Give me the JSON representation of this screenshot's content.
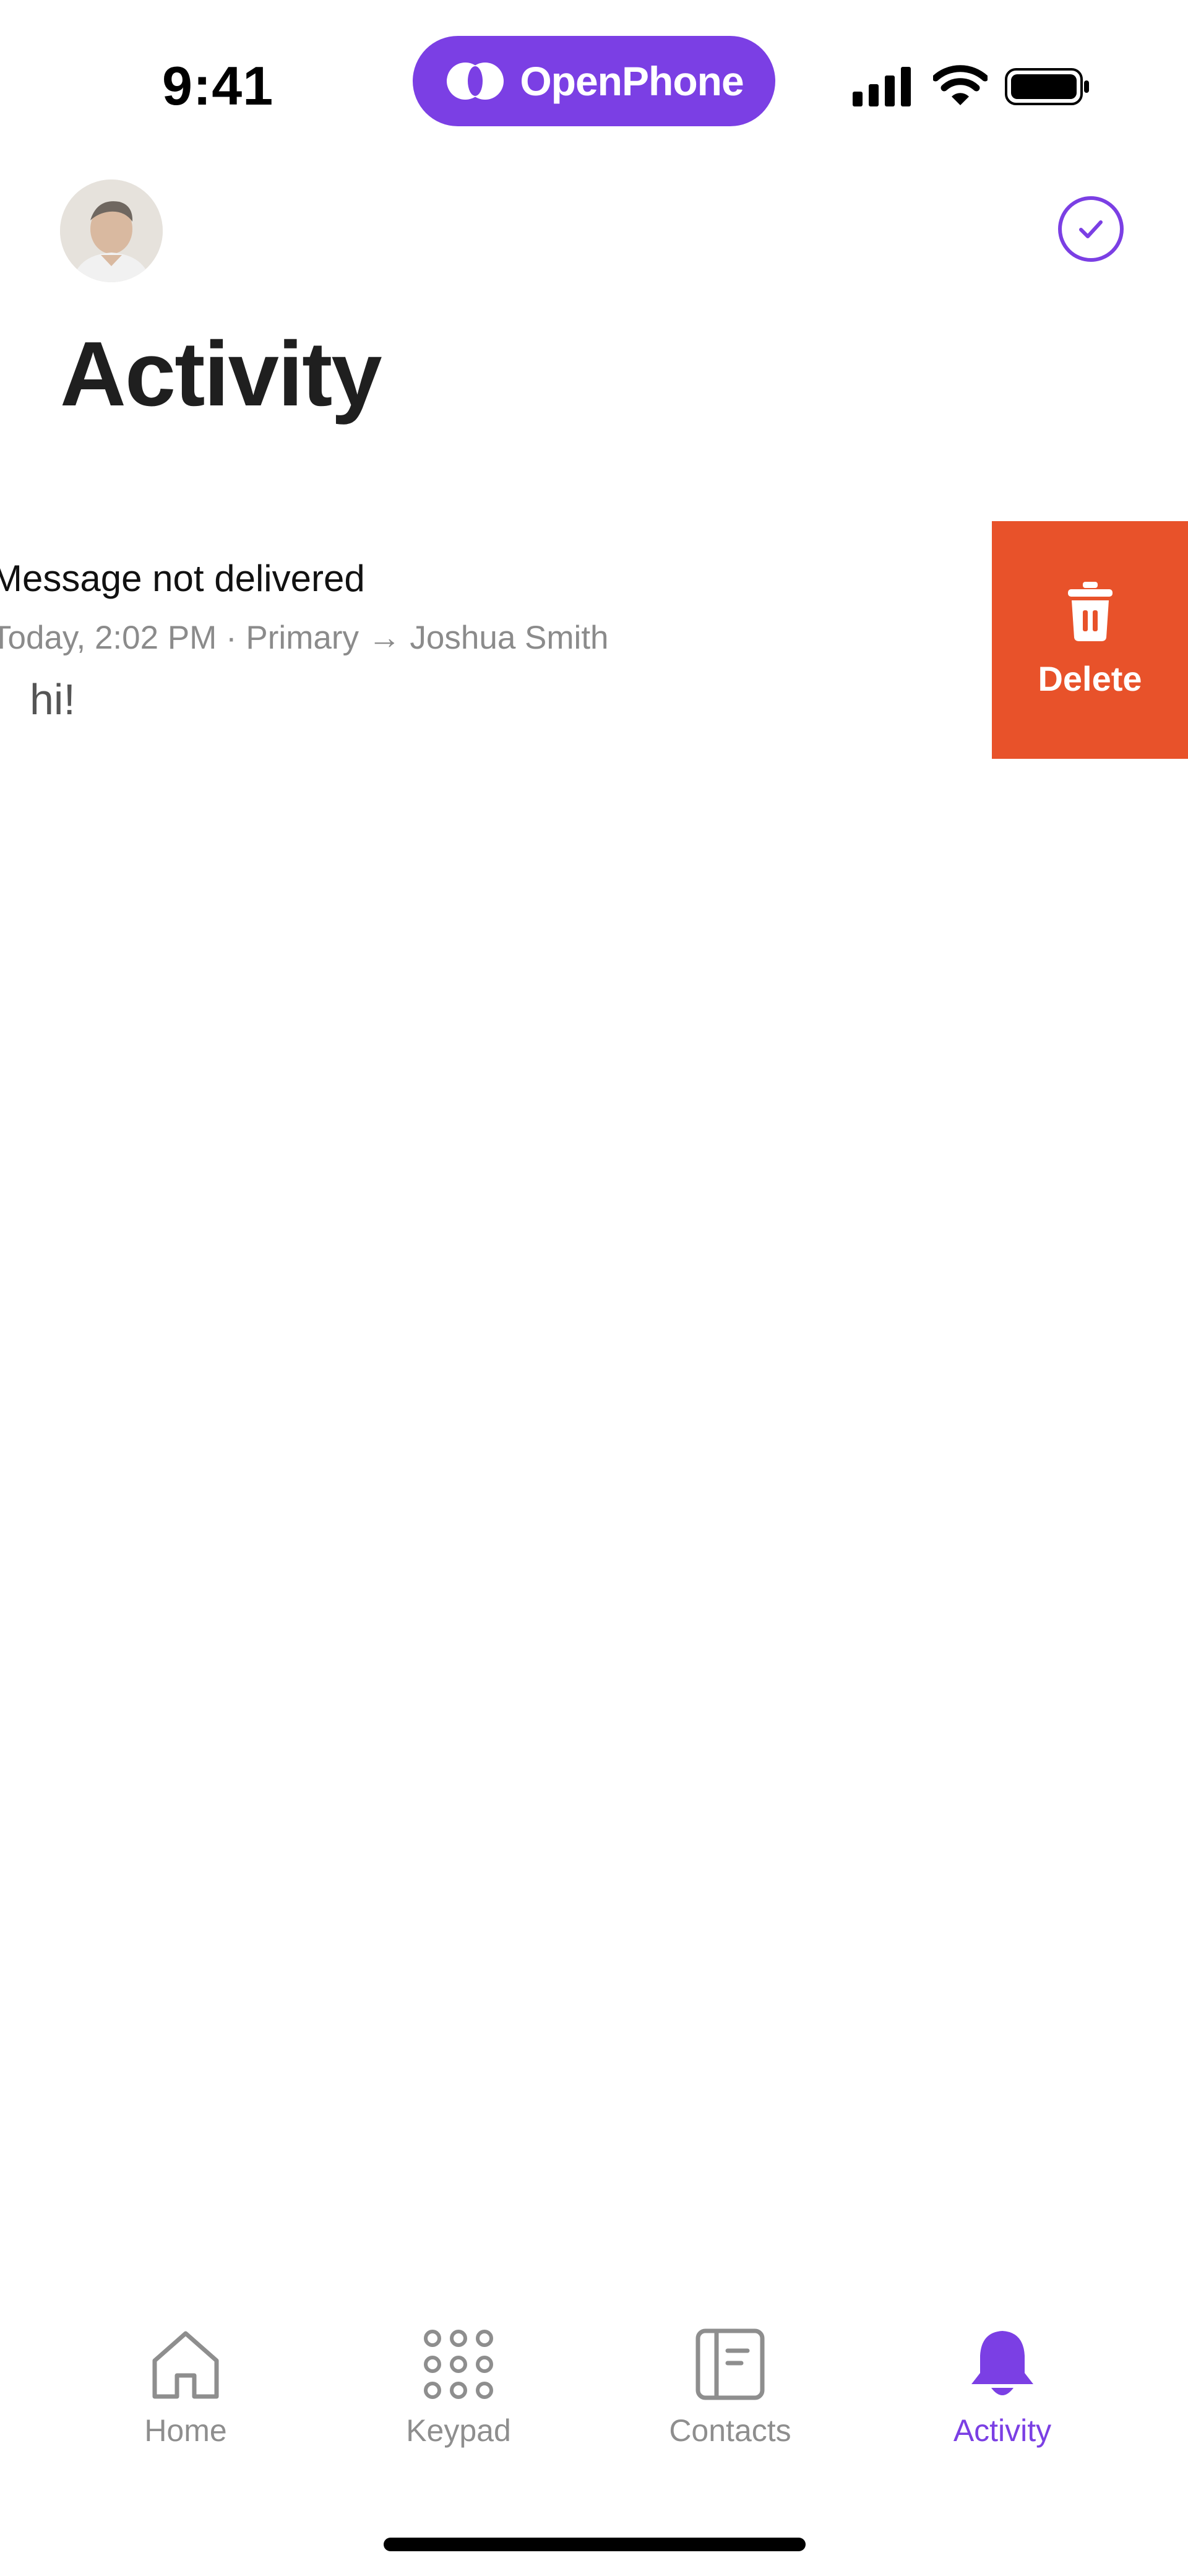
{
  "status_bar": {
    "time": "9:41",
    "brand": "OpenPhone",
    "icons": [
      "signal-icon",
      "wifi-icon",
      "battery-icon"
    ]
  },
  "header": {
    "title": "Activity",
    "avatar": "user-avatar",
    "action_icon": "check-circle-icon"
  },
  "activity": {
    "items": [
      {
        "title": "Message not delivered",
        "meta": "Today, 2:02 PM · Primary → Joshua Smith",
        "body": "hi!",
        "swipe_action": "Delete"
      }
    ]
  },
  "tabs": [
    {
      "label": "Home",
      "icon": "home-icon",
      "active": false
    },
    {
      "label": "Keypad",
      "icon": "keypad-icon",
      "active": false
    },
    {
      "label": "Contacts",
      "icon": "contacts-icon",
      "active": false
    },
    {
      "label": "Activity",
      "icon": "bell-icon",
      "active": true
    }
  ],
  "colors": {
    "accent": "#7b3fe4",
    "delete": "#e8522a",
    "inactive_tab": "#8e8e8e"
  }
}
